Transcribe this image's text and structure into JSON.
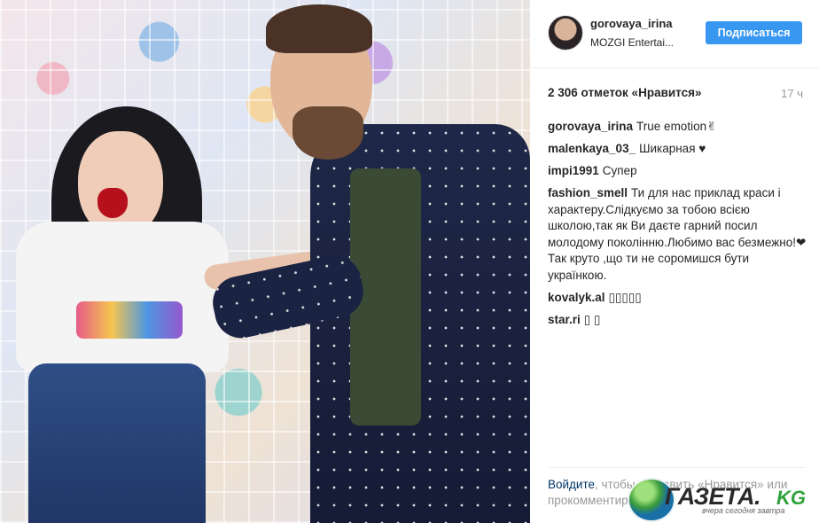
{
  "post": {
    "username": "gorovaya_irina",
    "location": "MOZGI Entertai...",
    "follow_label": "Подписаться",
    "likes": "2 306 отметок «Нравится»",
    "time_ago": "17 ч"
  },
  "comments": [
    {
      "user": "gorovaya_irina",
      "text": "True emotion✌"
    },
    {
      "user": "malenkaya_03_",
      "text": "Шикарная ♥"
    },
    {
      "user": "impi1991",
      "text": "Супер"
    },
    {
      "user": "fashion_smell",
      "text": "Ти для нас приклад краси і характеру.Слідкуємо за тобою всією школою,так як Ви даєте гарний посил молодому поколінню.Любимо вас безмежно!❤Так круто ,що ти не соромишся бути українкою."
    },
    {
      "user": "kovalyk.al",
      "text": "▯▯▯▯▯"
    },
    {
      "user": "star.ri",
      "text": "▯ ▯"
    }
  ],
  "footer": {
    "login_link": "Войдите",
    "text_after_link": ", чтобы поставить «Нравится» или прокомментировать."
  },
  "watermark": {
    "name": "ГАЗЕТА.",
    "tld": "KG",
    "tagline": "вчера сегодня завтра"
  },
  "colors": {
    "follow_button": "#3897f0",
    "link": "#003569",
    "muted": "#999999"
  },
  "icons": {
    "globe": "globe-icon"
  }
}
